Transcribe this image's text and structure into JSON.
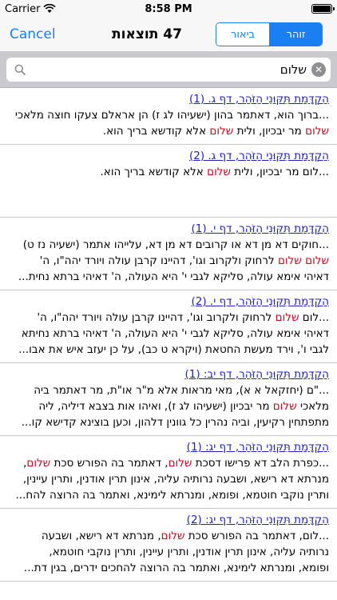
{
  "status": {
    "carrier": "Carrier",
    "time": "8:58 PM",
    "battery_level": 1.0
  },
  "nav": {
    "cancel_label": "Cancel",
    "title": "47 תוצאות",
    "segments": [
      {
        "label": "ביאור",
        "active": false
      },
      {
        "label": "זוהר",
        "active": true
      }
    ]
  },
  "search": {
    "value": "שלום",
    "placeholder": ""
  },
  "highlight_word": "שלום",
  "colors": {
    "accent": "#1a7ff1",
    "highlight": "#d0021b",
    "link": "#2222bb"
  },
  "results": [
    {
      "header": "הַקְדָּמַת תִּקּוּנֵי הַזֹּהַר, דף ג. (1)",
      "lines": [
        "...ברוך הוא, דאתמר בהון (ישעיהו לג ז) הן אראלם צעקו חוצה מלאכי",
        "שלום מר יבכיון, ולית שלום אלא קודשא בריך הוא."
      ]
    },
    {
      "header": "הַקְדָּמַת תִּקּוּנֵי הַזֹּהַר, דף ג. (2)",
      "lines": [
        "...לום מר יבכיון, ולית שלום אלא קודשא בריך הוא.",
        "",
        ""
      ]
    },
    {
      "header": "הַקְדָּמַת תִּקּוּנֵי הַזֹּהַר, דף י. (1)",
      "lines": [
        "...חוקים דא מן דא או קרובים דא מן דא, עלייהו אתמר (ישעיה נז ט)",
        "שלום שלום לרחוק ולקרוב וגו', דהיינו קרבן עולה ויורד יהה\"ו, ה'",
        "דאיהי אימא עולה, סליקא לגבי י' היא העולה, ה' דאיהי ברתא נחית..."
      ]
    },
    {
      "header": "הַקְדָּמַת תִּקּוּנֵי הַזֹּהַר, דף י. (2)",
      "lines": [
        "...לום שלום לרחוק ולקרוב וגו', דהיינו קרבן עולה ויורד יהה\"ו, ה'",
        "דאיהי אימא עולה, סליקא לגבי י' היא העולה, ה' דאיהי ברתא נחיתא",
        "לגבי ו', וירד מעשת החטאת (ויקרא ט כב), על כן יעזב איש את אבו..."
      ]
    },
    {
      "header": "הַקְדָּמַת תִּקּוּנֵי הַזֹּהַר, דף יב: (1)",
      "lines": [
        "...\"ם (יחזקאל א א), מאי מראות אלא מ\"ר או\"ת, מר דאתמר ביה",
        "מלאכי שלום מר יבכיון (ישעיהו לג ז), ואיהו אות בצבא דיליה, ליה",
        "מתפתחין רקיעין, וביה נהרין כל גוונין דלהון, וכען בוצינא קדישא קו..."
      ]
    },
    {
      "header": "הַקְדָּמַת תִּקּוּנֵי הַזֹּהַר, דף יג: (1)",
      "lines": [
        "...כפרת הלב דא פרישו דסכת שלום, דאתמר בה הפורש סכת שלום,",
        "מנרתא דא רישא, ושבעה נרותיה עליה, אינון תרין אודנין, ותרין עיינין,",
        "ותרין נוקבי חוטמא, ופומא, ומנרתא לימינא, ואתמר בה הרוצה להח..."
      ]
    },
    {
      "header": "הַקְדָּמַת תִּקּוּנֵי הַזֹּהַר, דף יג: (2)",
      "lines": [
        "...לום, דאתמר בה הפורש סכת שלום, מנרתא דא רישא, ושבעה",
        "נרותיה עליה, אינון תרין אודנין, ותרין עיינין, ותרין נוקבי חוטמא,",
        "ופומא, ומנרתא לימינא, ואתמר בה הרוצה להחכים ידרים, בגין דת..."
      ]
    }
  ]
}
